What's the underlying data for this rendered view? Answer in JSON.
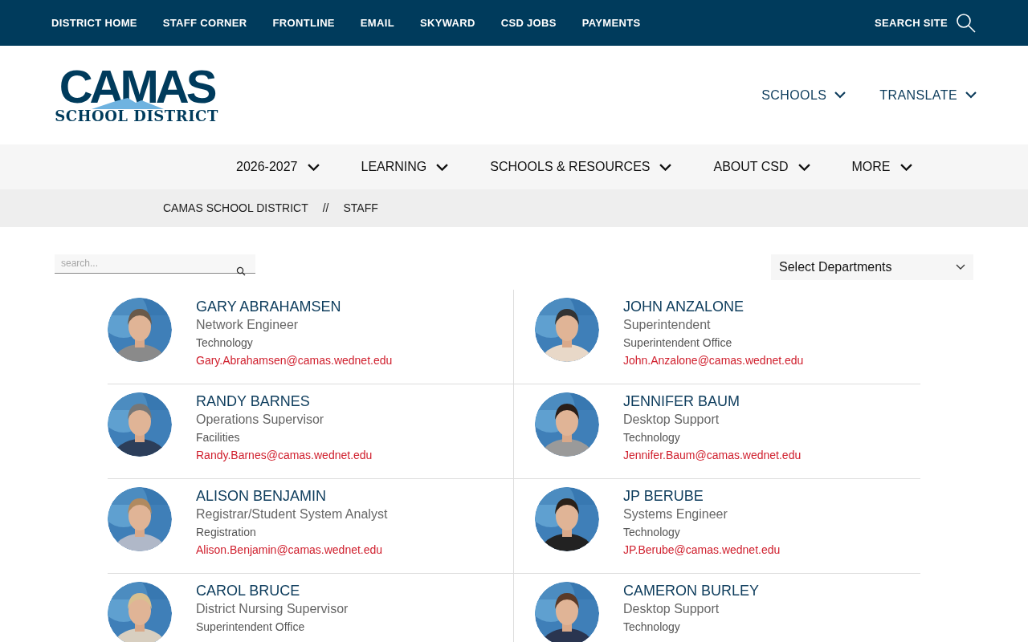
{
  "top_links": [
    "DISTRICT HOME",
    "STAFF CORNER",
    "FRONTLINE",
    "EMAIL",
    "SKYWARD",
    "CSD JOBS",
    "PAYMENTS"
  ],
  "search_site": "SEARCH SITE",
  "logo": {
    "title": "CAMAS",
    "subtitle": "SCHOOL DISTRICT"
  },
  "header_menus": [
    "SCHOOLS",
    "TRANSLATE"
  ],
  "main_nav": [
    "2026-2027",
    "LEARNING",
    "SCHOOLS & RESOURCES",
    "ABOUT CSD",
    "MORE"
  ],
  "breadcrumb": [
    "CAMAS SCHOOL DISTRICT",
    "STAFF"
  ],
  "breadcrumb_separator": "//",
  "staff_search": {
    "placeholder": "search..."
  },
  "department_select": {
    "value": "Select Departments"
  },
  "staff": [
    {
      "name": "GARY ABRAHAMSEN",
      "title": "Network Engineer",
      "department": "Technology",
      "email": "Gary.Abrahamsen@camas.wednet.edu"
    },
    {
      "name": "JOHN ANZALONE",
      "title": "Superintendent",
      "department": "Superintendent Office",
      "email": "John.Anzalone@camas.wednet.edu"
    },
    {
      "name": "RANDY BARNES",
      "title": "Operations Supervisor",
      "department": "Facilities",
      "email": "Randy.Barnes@camas.wednet.edu"
    },
    {
      "name": "JENNIFER BAUM",
      "title": "Desktop Support",
      "department": "Technology",
      "email": "Jennifer.Baum@camas.wednet.edu"
    },
    {
      "name": "ALISON BENJAMIN",
      "title": "Registrar/Student System Analyst",
      "department": "Registration",
      "email": "Alison.Benjamin@camas.wednet.edu"
    },
    {
      "name": "JP BERUBE",
      "title": "Systems Engineer",
      "department": "Technology",
      "email": "JP.Berube@camas.wednet.edu"
    },
    {
      "name": "CAROL BRUCE",
      "title": "District Nursing Supervisor",
      "department": "Superintendent Office"
    },
    {
      "name": "CAMERON BURLEY",
      "title": "Desktop Support",
      "department": "Technology"
    }
  ]
}
